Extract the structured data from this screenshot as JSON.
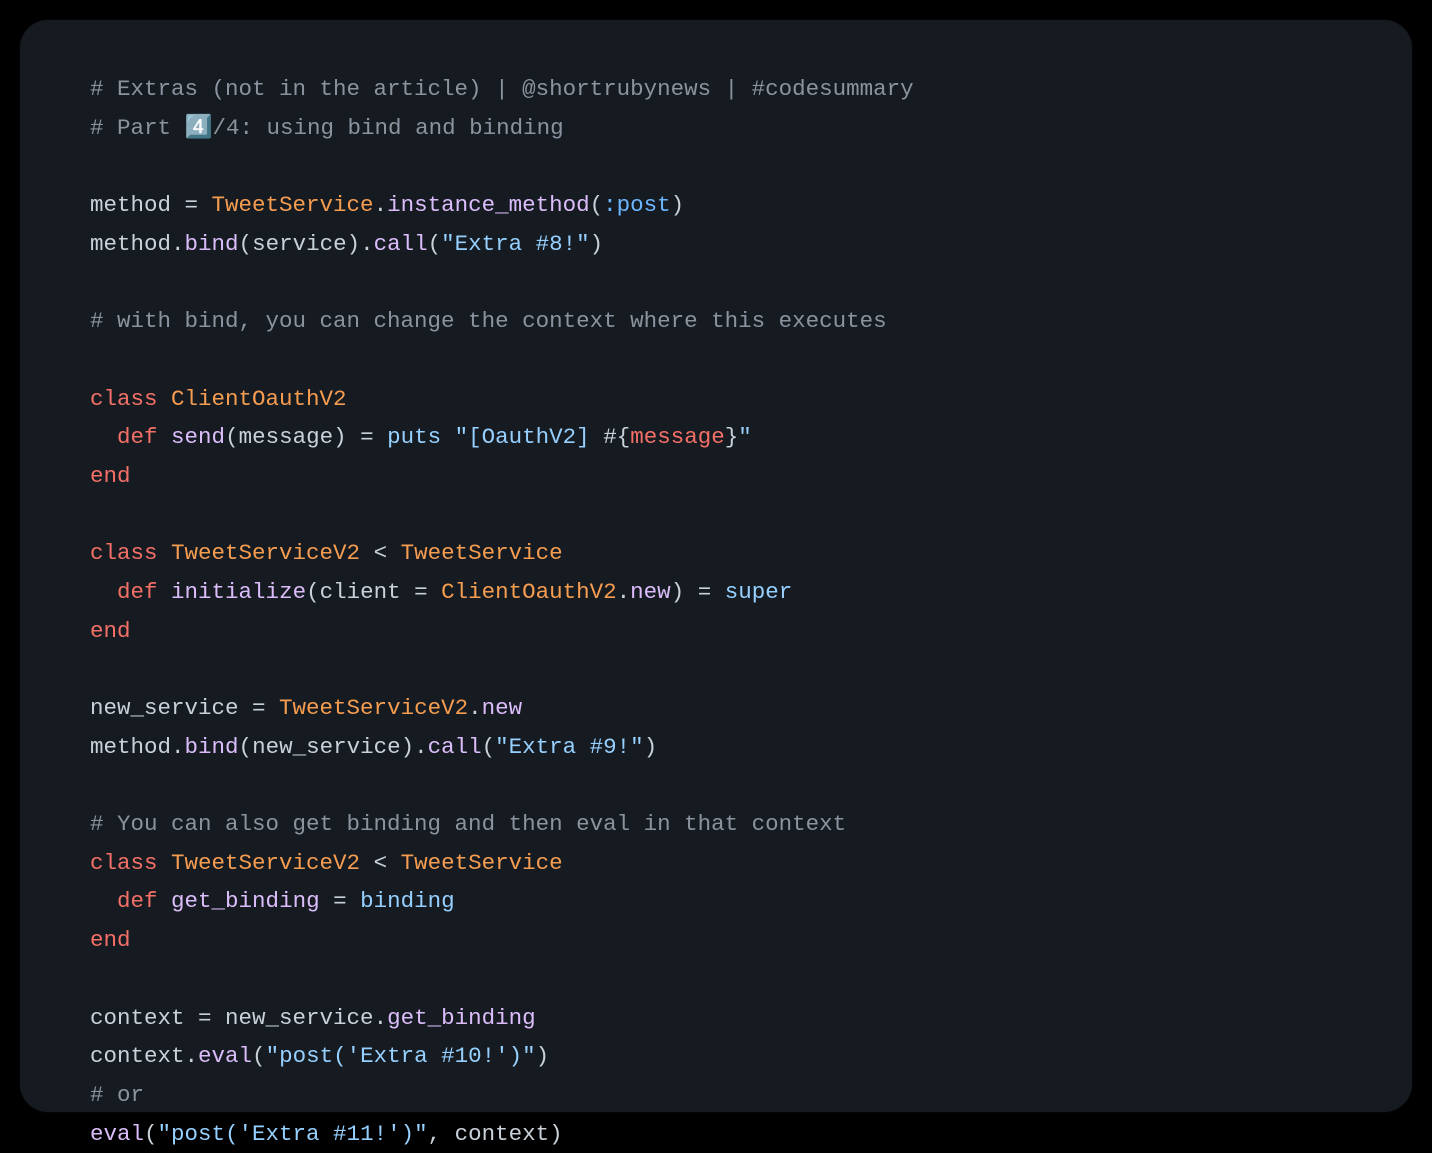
{
  "lines": [
    [
      {
        "cls": "comment",
        "text": "# Extras (not in the article) | @shortrubynews | #codesummary"
      }
    ],
    [
      {
        "cls": "comment",
        "text": "# Part 4️⃣/4: using bind and binding"
      }
    ],
    [],
    [
      {
        "cls": "ident",
        "text": "method"
      },
      {
        "cls": "op",
        "text": " = "
      },
      {
        "cls": "const",
        "text": "TweetService"
      },
      {
        "cls": "op",
        "text": "."
      },
      {
        "cls": "call",
        "text": "instance_method"
      },
      {
        "cls": "paren",
        "text": "("
      },
      {
        "cls": "symbol",
        "text": ":post"
      },
      {
        "cls": "paren",
        "text": ")"
      }
    ],
    [
      {
        "cls": "ident",
        "text": "method"
      },
      {
        "cls": "op",
        "text": "."
      },
      {
        "cls": "call",
        "text": "bind"
      },
      {
        "cls": "paren",
        "text": "("
      },
      {
        "cls": "ident",
        "text": "service"
      },
      {
        "cls": "paren",
        "text": ")"
      },
      {
        "cls": "op",
        "text": "."
      },
      {
        "cls": "call",
        "text": "call"
      },
      {
        "cls": "paren",
        "text": "("
      },
      {
        "cls": "string",
        "text": "\"Extra #8!\""
      },
      {
        "cls": "paren",
        "text": ")"
      }
    ],
    [],
    [
      {
        "cls": "comment",
        "text": "# with bind, you can change the context where this executes"
      }
    ],
    [],
    [
      {
        "cls": "keyword",
        "text": "class"
      },
      {
        "cls": "op",
        "text": " "
      },
      {
        "cls": "const",
        "text": "ClientOauthV2"
      }
    ],
    [
      {
        "cls": "op",
        "text": "  "
      },
      {
        "cls": "keyword",
        "text": "def"
      },
      {
        "cls": "op",
        "text": " "
      },
      {
        "cls": "methdef",
        "text": "send"
      },
      {
        "cls": "paren",
        "text": "("
      },
      {
        "cls": "ident",
        "text": "message"
      },
      {
        "cls": "paren",
        "text": ")"
      },
      {
        "cls": "op",
        "text": " = "
      },
      {
        "cls": "putskw",
        "text": "puts"
      },
      {
        "cls": "op",
        "text": " "
      },
      {
        "cls": "string",
        "text": "\"[OauthV2] "
      },
      {
        "cls": "interp",
        "text": "#{"
      },
      {
        "cls": "interpvar",
        "text": "message"
      },
      {
        "cls": "interp",
        "text": "}"
      },
      {
        "cls": "string",
        "text": "\""
      }
    ],
    [
      {
        "cls": "keyword",
        "text": "end"
      }
    ],
    [],
    [
      {
        "cls": "keyword",
        "text": "class"
      },
      {
        "cls": "op",
        "text": " "
      },
      {
        "cls": "const",
        "text": "TweetServiceV2"
      },
      {
        "cls": "op",
        "text": " < "
      },
      {
        "cls": "const",
        "text": "TweetService"
      }
    ],
    [
      {
        "cls": "op",
        "text": "  "
      },
      {
        "cls": "keyword",
        "text": "def"
      },
      {
        "cls": "op",
        "text": " "
      },
      {
        "cls": "methdef",
        "text": "initialize"
      },
      {
        "cls": "paren",
        "text": "("
      },
      {
        "cls": "ident",
        "text": "client"
      },
      {
        "cls": "op",
        "text": " = "
      },
      {
        "cls": "const",
        "text": "ClientOauthV2"
      },
      {
        "cls": "op",
        "text": "."
      },
      {
        "cls": "newkw",
        "text": "new"
      },
      {
        "cls": "paren",
        "text": ")"
      },
      {
        "cls": "op",
        "text": " = "
      },
      {
        "cls": "superkw",
        "text": "super"
      }
    ],
    [
      {
        "cls": "keyword",
        "text": "end"
      }
    ],
    [],
    [
      {
        "cls": "ident",
        "text": "new_service"
      },
      {
        "cls": "op",
        "text": " = "
      },
      {
        "cls": "const",
        "text": "TweetServiceV2"
      },
      {
        "cls": "op",
        "text": "."
      },
      {
        "cls": "newkw",
        "text": "new"
      }
    ],
    [
      {
        "cls": "ident",
        "text": "method"
      },
      {
        "cls": "op",
        "text": "."
      },
      {
        "cls": "call",
        "text": "bind"
      },
      {
        "cls": "paren",
        "text": "("
      },
      {
        "cls": "ident",
        "text": "new_service"
      },
      {
        "cls": "paren",
        "text": ")"
      },
      {
        "cls": "op",
        "text": "."
      },
      {
        "cls": "call",
        "text": "call"
      },
      {
        "cls": "paren",
        "text": "("
      },
      {
        "cls": "string",
        "text": "\"Extra #9!\""
      },
      {
        "cls": "paren",
        "text": ")"
      }
    ],
    [],
    [
      {
        "cls": "comment",
        "text": "# You can also get binding and then eval in that context"
      }
    ],
    [
      {
        "cls": "keyword",
        "text": "class"
      },
      {
        "cls": "op",
        "text": " "
      },
      {
        "cls": "const",
        "text": "TweetServiceV2"
      },
      {
        "cls": "op",
        "text": " < "
      },
      {
        "cls": "const",
        "text": "TweetService"
      }
    ],
    [
      {
        "cls": "op",
        "text": "  "
      },
      {
        "cls": "keyword",
        "text": "def"
      },
      {
        "cls": "op",
        "text": " "
      },
      {
        "cls": "methdef",
        "text": "get_binding"
      },
      {
        "cls": "op",
        "text": " = "
      },
      {
        "cls": "bindkw",
        "text": "binding"
      }
    ],
    [
      {
        "cls": "keyword",
        "text": "end"
      }
    ],
    [],
    [
      {
        "cls": "ident",
        "text": "context"
      },
      {
        "cls": "op",
        "text": " = "
      },
      {
        "cls": "ident",
        "text": "new_service"
      },
      {
        "cls": "op",
        "text": "."
      },
      {
        "cls": "call",
        "text": "get_binding"
      }
    ],
    [
      {
        "cls": "ident",
        "text": "context"
      },
      {
        "cls": "op",
        "text": "."
      },
      {
        "cls": "evalkw",
        "text": "eval"
      },
      {
        "cls": "paren",
        "text": "("
      },
      {
        "cls": "string",
        "text": "\"post('Extra #10!')\""
      },
      {
        "cls": "paren",
        "text": ")"
      }
    ],
    [
      {
        "cls": "comment",
        "text": "# or"
      }
    ],
    [
      {
        "cls": "evalkw",
        "text": "eval"
      },
      {
        "cls": "paren",
        "text": "("
      },
      {
        "cls": "string",
        "text": "\"post('Extra #11!')\""
      },
      {
        "cls": "op",
        "text": ", "
      },
      {
        "cls": "ident",
        "text": "context"
      },
      {
        "cls": "paren",
        "text": ")"
      }
    ]
  ]
}
